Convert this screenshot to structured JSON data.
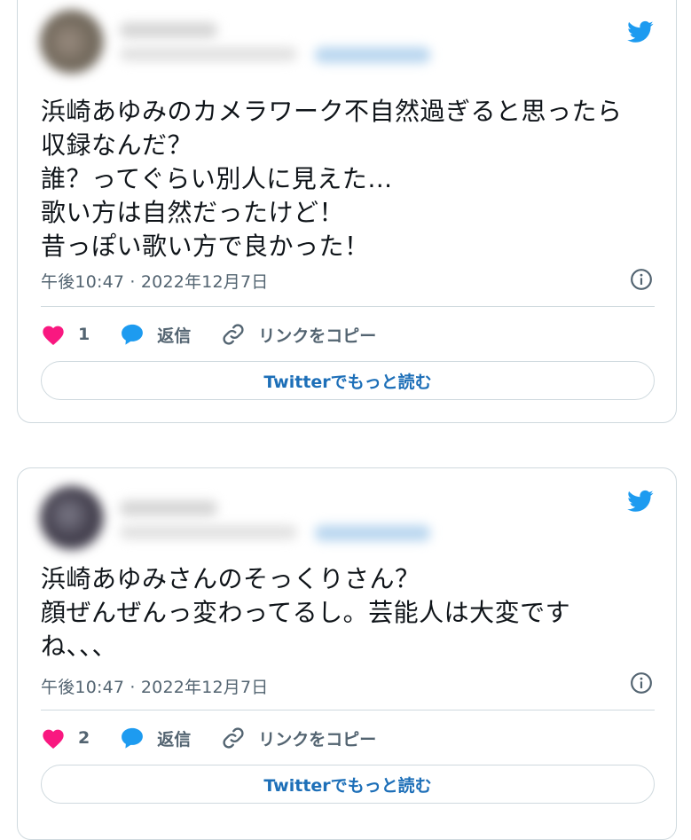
{
  "colors": {
    "accent": "#1d9bf0",
    "like": "#f91880",
    "muted": "#536471",
    "border": "#cfd9de"
  },
  "tweets": [
    {
      "text": "浜崎あゆみのカメラワーク不自然過ぎると思ったら\n収録なんだ？\n誰？ってぐらい別人に見えた…\n歌い方は自然だったけど！\n昔っぽい歌い方で良かった！",
      "timestamp": "午後10:47 · 2022年12月7日",
      "likes": "1",
      "reply_label": "返信",
      "copy_label": "リンクをコピー",
      "more_label": "Twitterでもっと読む"
    },
    {
      "text": "浜崎あゆみさんのそっくりさん？\n顔ぜんぜんっ変わってるし。芸能人は大変です\nね、、、",
      "timestamp": "午後10:47 · 2022年12月7日",
      "likes": "2",
      "reply_label": "返信",
      "copy_label": "リンクをコピー",
      "more_label": "Twitterでもっと読む"
    }
  ]
}
